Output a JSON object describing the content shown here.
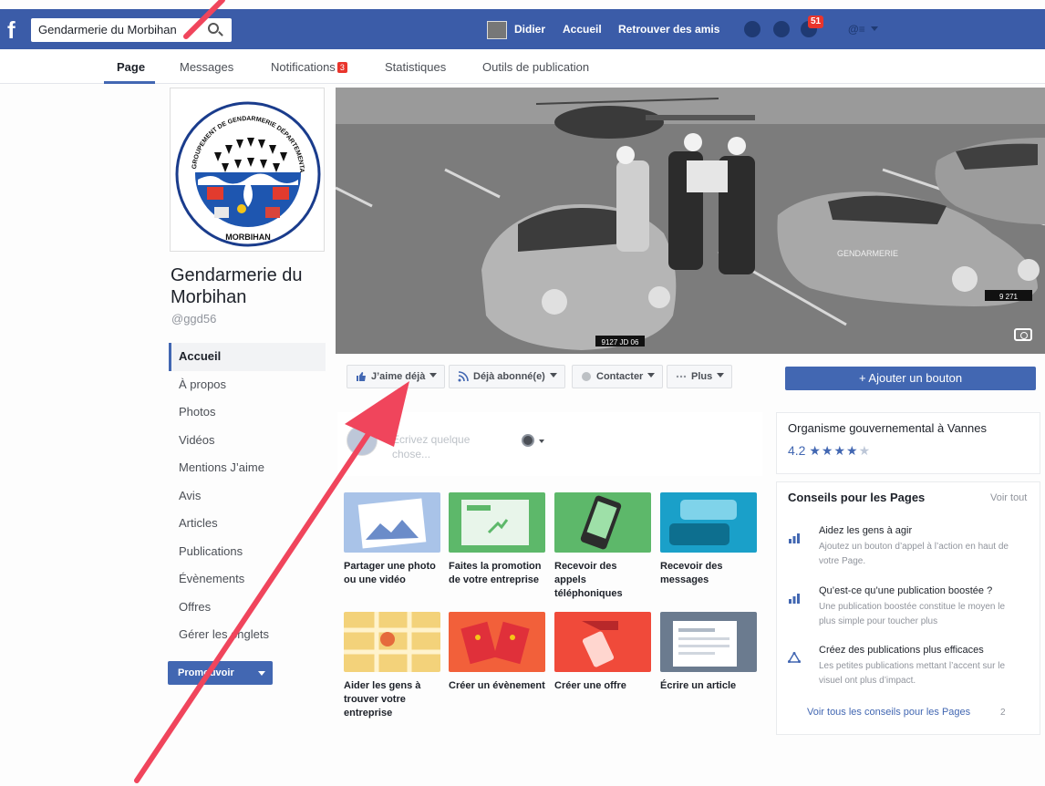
{
  "topbar": {
    "search_value": "Gendarmerie du Morbihan",
    "user_name": "Didier",
    "nav_home": "Accueil",
    "nav_find_friends": "Retrouver des amis",
    "notifications_count": "51",
    "quick_settings": "@≡",
    "brand_color": "#3b5ca8"
  },
  "tabs": {
    "page": "Page",
    "messages": "Messages",
    "notifications": "Notifications",
    "notifications_badge": "3",
    "stats": "Statistiques",
    "publishing_tools": "Outils de publication"
  },
  "profile": {
    "name": "Gendarmerie du Morbihan",
    "handle": "@ggd56",
    "logo_top_text": "GROUPEMENT DE GENDARMERIE DÉPARTEMENTALE",
    "logo_bottom_text": "MORBIHAN"
  },
  "sidebar": {
    "items": [
      {
        "label": "Accueil"
      },
      {
        "label": "À propos"
      },
      {
        "label": "Photos"
      },
      {
        "label": "Vidéos"
      },
      {
        "label": "Mentions J’aime"
      },
      {
        "label": "Avis"
      },
      {
        "label": "Articles"
      },
      {
        "label": "Publications"
      },
      {
        "label": "Évènements"
      },
      {
        "label": "Offres"
      },
      {
        "label": "Gérer les onglets"
      }
    ],
    "promote_label": "Promouvoir"
  },
  "cover": {
    "plate_left": "9127 JD 06",
    "plate_right": "9 271",
    "car_door_text": "GENDARMERIE"
  },
  "actions": {
    "like": "J’aime déjà",
    "follow": "Déjà abonné(e)",
    "contact": "Contacter",
    "more": "Plus",
    "add_button": "+ Ajouter un bouton"
  },
  "composer": {
    "placeholder_line1": "Écrivez quelque",
    "placeholder_line2": "chose..."
  },
  "cards": [
    {
      "label": "Partager une photo ou une vidéo"
    },
    {
      "label": "Faites la promotion de votre entreprise"
    },
    {
      "label": "Recevoir des appels téléphoniques"
    },
    {
      "label": "Recevoir des messages"
    },
    {
      "label": "Aider les gens à trouver votre entreprise"
    },
    {
      "label": "Créer un évènement"
    },
    {
      "label": "Créer une offre"
    },
    {
      "label": "Écrire un article"
    }
  ],
  "right": {
    "category": "Organisme gouvernemental à Vannes",
    "rating_value": "4.2",
    "rating_stars": 4.2,
    "tips_title": "Conseils pour les Pages",
    "see_all": "Voir tout",
    "tips": [
      {
        "title": "Aidez les gens à agir",
        "desc": "Ajoutez un bouton d’appel à l’action en haut de votre Page."
      },
      {
        "title": "Qu’est-ce qu’une publication boostée ?",
        "desc": "Une publication boostée constitue le moyen le plus simple pour toucher plus"
      },
      {
        "title": "Créez des publications plus efficaces",
        "desc": "Les petites publications mettant l’accent sur le visuel ont plus d’impact."
      }
    ],
    "see_all_tips": "Voir tous les conseils pour les Pages",
    "see_all_tips_count": "2"
  },
  "colors": {
    "accent": "#4267b2",
    "annotation_arrow": "#f0455c"
  }
}
